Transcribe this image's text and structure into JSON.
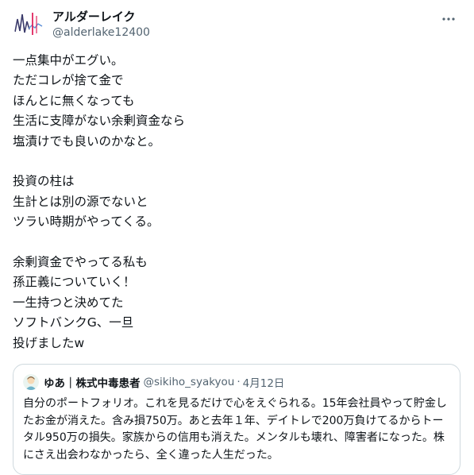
{
  "author": {
    "display_name": "アルダーレイク",
    "handle": "@alderlake12400"
  },
  "tweet": {
    "text": "一点集中がエグい。\nただコレが捨て金で\nほんとに無くなっても\n生活に支障がない余剰資金なら\n塩漬けでも良いのかなと。\n\n投資の柱は\n生計とは別の源でないと\nツラい時期がやってくる。\n\n余剰資金でやってる私も\n孫正義についていく！\n一生持つと決めてた\nソフトバンクG、一旦\n投げましたw"
  },
  "quoted_tweet": {
    "display_name": "ゆあ｜株式中毒患者",
    "handle": "@sikiho_syakyou",
    "separator": "·",
    "date": "4月12日",
    "text": "自分のポートフォリオ。これを見るだけで心をえぐられる。15年会社員やって貯金したお金が消えた。含み損750万。あと去年１年、デイトレで200万負けてるからトータル950万の損失。家族からの信用も消えた。メンタルも壊れ、障害者になった。株にさえ出会わなかったら、全く違った人生だった。"
  },
  "icons": {
    "more": "more-horizontal-icon"
  },
  "colors": {
    "text_primary": "#0f1419",
    "text_secondary": "#536471",
    "border": "#cfd9de",
    "avatar_accent": "#e0245e"
  }
}
